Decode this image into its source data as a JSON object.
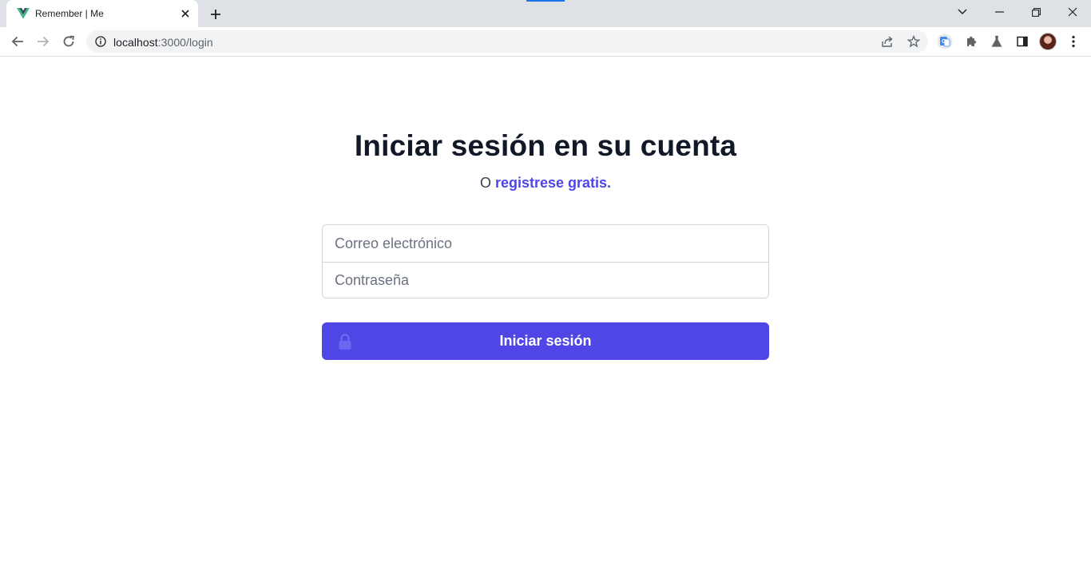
{
  "browser": {
    "tab": {
      "title": "Remember | Me",
      "favicon": "vue-logo-icon"
    },
    "url": {
      "host": "localhost",
      "rest": ":3000/login"
    }
  },
  "page": {
    "heading": "Iniciar sesión en su cuenta",
    "sub_prefix": "O",
    "register_link": "registrese gratis.",
    "email_placeholder": "Correo electrónico",
    "password_placeholder": "Contraseña",
    "submit_label": "Iniciar sesión"
  },
  "colors": {
    "accent": "#4f46e5",
    "heading": "#111827",
    "chrome_bg": "#dee1e6"
  }
}
